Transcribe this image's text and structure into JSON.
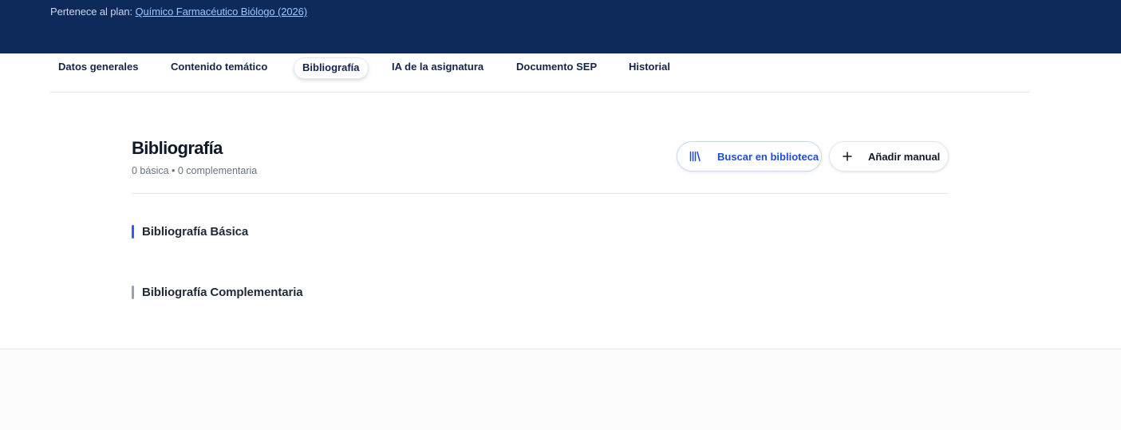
{
  "header": {
    "plan_prefix": "Pertenece al plan:",
    "plan_link": "Químico Farmacéutico Biólogo (2026)"
  },
  "tabs": [
    {
      "label": "Datos generales",
      "active": false
    },
    {
      "label": "Contenido temático",
      "active": false
    },
    {
      "label": "Bibliografía",
      "active": true
    },
    {
      "label": "IA de la asignatura",
      "active": false
    },
    {
      "label": "Documento SEP",
      "active": false
    },
    {
      "label": "Historial",
      "active": false
    }
  ],
  "section": {
    "title": "Bibliografía",
    "subtitle": "0 básica • 0 complementaria"
  },
  "actions": {
    "search_label": "Buscar en biblioteca",
    "search_icon": "library-icon",
    "add_label": "Añadir manual",
    "add_icon": "plus-icon"
  },
  "subsections": [
    {
      "label": "Bibliografía Básica",
      "accent_color": "#2563eb"
    },
    {
      "label": "Bibliografía Complementaria",
      "accent_color": "#94a3b8"
    }
  ],
  "colors": {
    "header_bg": "#0e2a5b",
    "link": "#9cc4ff",
    "primary": "#1d4ed8"
  }
}
